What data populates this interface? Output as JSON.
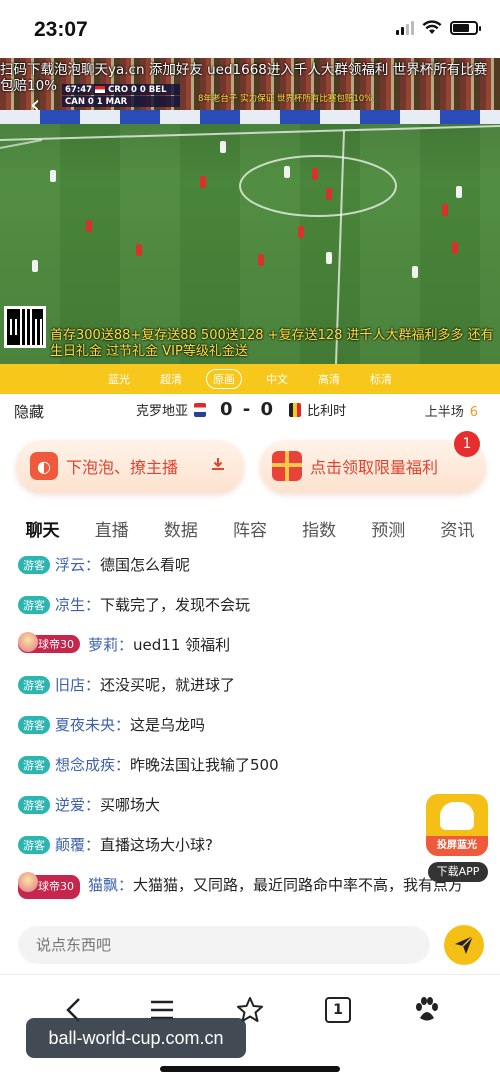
{
  "status": {
    "time": "23:07"
  },
  "video": {
    "marquee": "扫码下载泡泡聊天ya.cn 添加好友 ued1668进入千人大群领福利 世界杯所有比赛包赔10%",
    "scorebug": {
      "clock": "67:47",
      "row1": "CRO 0 0 BEL",
      "row2": "CAN 0 1 MAR"
    },
    "overlay_promo": "8年老台子 实力保证 世界杯所有比赛包赔10%",
    "bottom_promo": "首存300送88+复存送88 500送128 +复存送128 进千人大群福利多多 还有生日礼金 过节礼金 VIP等级礼金送",
    "colors": {
      "promo_yellow": "#ffe23a",
      "grass": "#4c8a3c"
    }
  },
  "quality": {
    "options": [
      "蓝光",
      "超清",
      "原画",
      "中文",
      "高清",
      "标清"
    ],
    "active": "原画"
  },
  "match": {
    "hide": "隐藏",
    "home": "克罗地亚",
    "score": "0 - 0",
    "away": "比利时",
    "period": "上半场",
    "minute": "6"
  },
  "actions": {
    "left_label": "下泡泡、撩主播",
    "right_label": "点击领取限量福利",
    "badge": "1"
  },
  "tabs": [
    "聊天",
    "直播",
    "数据",
    "阵容",
    "指数",
    "预测",
    "资讯"
  ],
  "chat": {
    "guest_tag": "游客",
    "vip_tag": "球帝30",
    "messages": [
      {
        "tag": "游客",
        "user": "浮云：",
        "text": "德国怎么看呢"
      },
      {
        "tag": "游客",
        "user": "凉生：",
        "text": "下载完了，发现不会玩"
      },
      {
        "tag": "球帝30",
        "user": "萝莉：",
        "text": "ued11 领福利"
      },
      {
        "tag": "游客",
        "user": "旧店：",
        "text": "还没买呢，就进球了"
      },
      {
        "tag": "游客",
        "user": "夏夜未央：",
        "text": "这是乌龙吗"
      },
      {
        "tag": "游客",
        "user": "想念成疾：",
        "text": "昨晚法国让我输了500"
      },
      {
        "tag": "游客",
        "user": "逆爱：",
        "text": "买哪场大"
      },
      {
        "tag": "游客",
        "user": "颠覆：",
        "text": "直播这场大小球?"
      },
      {
        "tag": "球帝30",
        "user": "猫飘：",
        "text": "大猫猫，又同路，最近同路命中率不高，我有点方"
      }
    ]
  },
  "float_ad": {
    "label": "投屏蓝光",
    "download": "下载APP"
  },
  "input": {
    "placeholder": "说点东西吧"
  },
  "browser": {
    "tab_count": "1"
  },
  "watermark": "ball-world-cup.com.cn"
}
